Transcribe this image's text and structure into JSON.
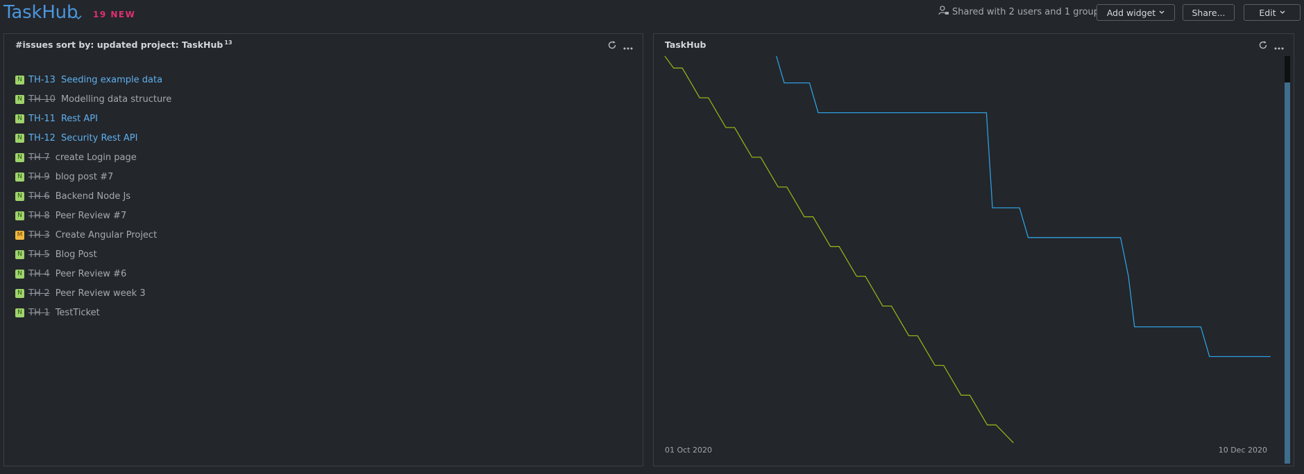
{
  "header": {
    "title": "TaskHub",
    "new_badge": "19 NEW",
    "shared_text": "Shared with 2 users and 1 group",
    "add_widget_label": "Add widget",
    "share_label": "Share...",
    "edit_label": "Edit"
  },
  "issues_widget": {
    "title": "#issues sort by: updated project: TaskHub",
    "count": "13",
    "issues": [
      {
        "priority": "N",
        "id": "TH-13",
        "summary": "Seeding example data",
        "resolved": false
      },
      {
        "priority": "N",
        "id": "TH-10",
        "summary": "Modelling data structure",
        "resolved": true
      },
      {
        "priority": "N",
        "id": "TH-11",
        "summary": "Rest API",
        "resolved": false
      },
      {
        "priority": "N",
        "id": "TH-12",
        "summary": "Security Rest API",
        "resolved": false
      },
      {
        "priority": "N",
        "id": "TH-7",
        "summary": "create Login page",
        "resolved": true
      },
      {
        "priority": "N",
        "id": "TH-9",
        "summary": "blog post #7",
        "resolved": true
      },
      {
        "priority": "N",
        "id": "TH-6",
        "summary": "Backend Node Js",
        "resolved": true
      },
      {
        "priority": "N",
        "id": "TH-8",
        "summary": "Peer Review #7",
        "resolved": true
      },
      {
        "priority": "M",
        "id": "TH-3",
        "summary": "Create Angular Project",
        "resolved": true
      },
      {
        "priority": "N",
        "id": "TH-5",
        "summary": "Blog Post",
        "resolved": true
      },
      {
        "priority": "N",
        "id": "TH-4",
        "summary": "Peer Review #6",
        "resolved": true
      },
      {
        "priority": "N",
        "id": "TH-2",
        "summary": "Peer Review week 3",
        "resolved": true
      },
      {
        "priority": "N",
        "id": "TH-1",
        "summary": "TestTicket",
        "resolved": true
      }
    ]
  },
  "chart_widget": {
    "title": "TaskHub"
  },
  "chart_data": {
    "type": "line",
    "x_start_label": "01 Oct 2020",
    "x_end_label": "10 Dec 2020",
    "x_range_days": [
      0,
      70
    ],
    "y_range": [
      0,
      13
    ],
    "series": [
      {
        "color": "#8fb31b",
        "points": [
          [
            0,
            13
          ],
          [
            1,
            12.6
          ],
          [
            2,
            12.6
          ],
          [
            3,
            12.1
          ],
          [
            4,
            11.6
          ],
          [
            5,
            11.6
          ],
          [
            6,
            11.1
          ],
          [
            7,
            10.6
          ],
          [
            8,
            10.6
          ],
          [
            9,
            10.1
          ],
          [
            10,
            9.6
          ],
          [
            11,
            9.6
          ],
          [
            12,
            9.1
          ],
          [
            13,
            8.6
          ],
          [
            14,
            8.6
          ],
          [
            15,
            8.1
          ],
          [
            16,
            7.6
          ],
          [
            17,
            7.6
          ],
          [
            18,
            7.1
          ],
          [
            19,
            6.6
          ],
          [
            20,
            6.6
          ],
          [
            21,
            6.1
          ],
          [
            22,
            5.6
          ],
          [
            23,
            5.6
          ],
          [
            24,
            5.1
          ],
          [
            25,
            4.6
          ],
          [
            26,
            4.6
          ],
          [
            27,
            4.1
          ],
          [
            28,
            3.6
          ],
          [
            29,
            3.6
          ],
          [
            30,
            3.1
          ],
          [
            31,
            2.6
          ],
          [
            32,
            2.6
          ],
          [
            33,
            2.1
          ],
          [
            34,
            1.6
          ],
          [
            35,
            1.6
          ],
          [
            36,
            1.1
          ],
          [
            37,
            0.6
          ],
          [
            38,
            0.6
          ],
          [
            39,
            0.3
          ],
          [
            40,
            0
          ]
        ]
      },
      {
        "color": "#2f9fe0",
        "points": [
          [
            12.8,
            13
          ],
          [
            13.7,
            12.1
          ],
          [
            16.6,
            12.1
          ],
          [
            17.6,
            11.1
          ],
          [
            36.9,
            11.1
          ],
          [
            37.6,
            7.9
          ],
          [
            40.7,
            7.9
          ],
          [
            41.7,
            6.9
          ],
          [
            52.3,
            6.9
          ],
          [
            53.2,
            5.6
          ],
          [
            53.9,
            3.9
          ],
          [
            61.5,
            3.9
          ],
          [
            62.5,
            2.9
          ],
          [
            69.5,
            2.9
          ]
        ]
      }
    ]
  }
}
